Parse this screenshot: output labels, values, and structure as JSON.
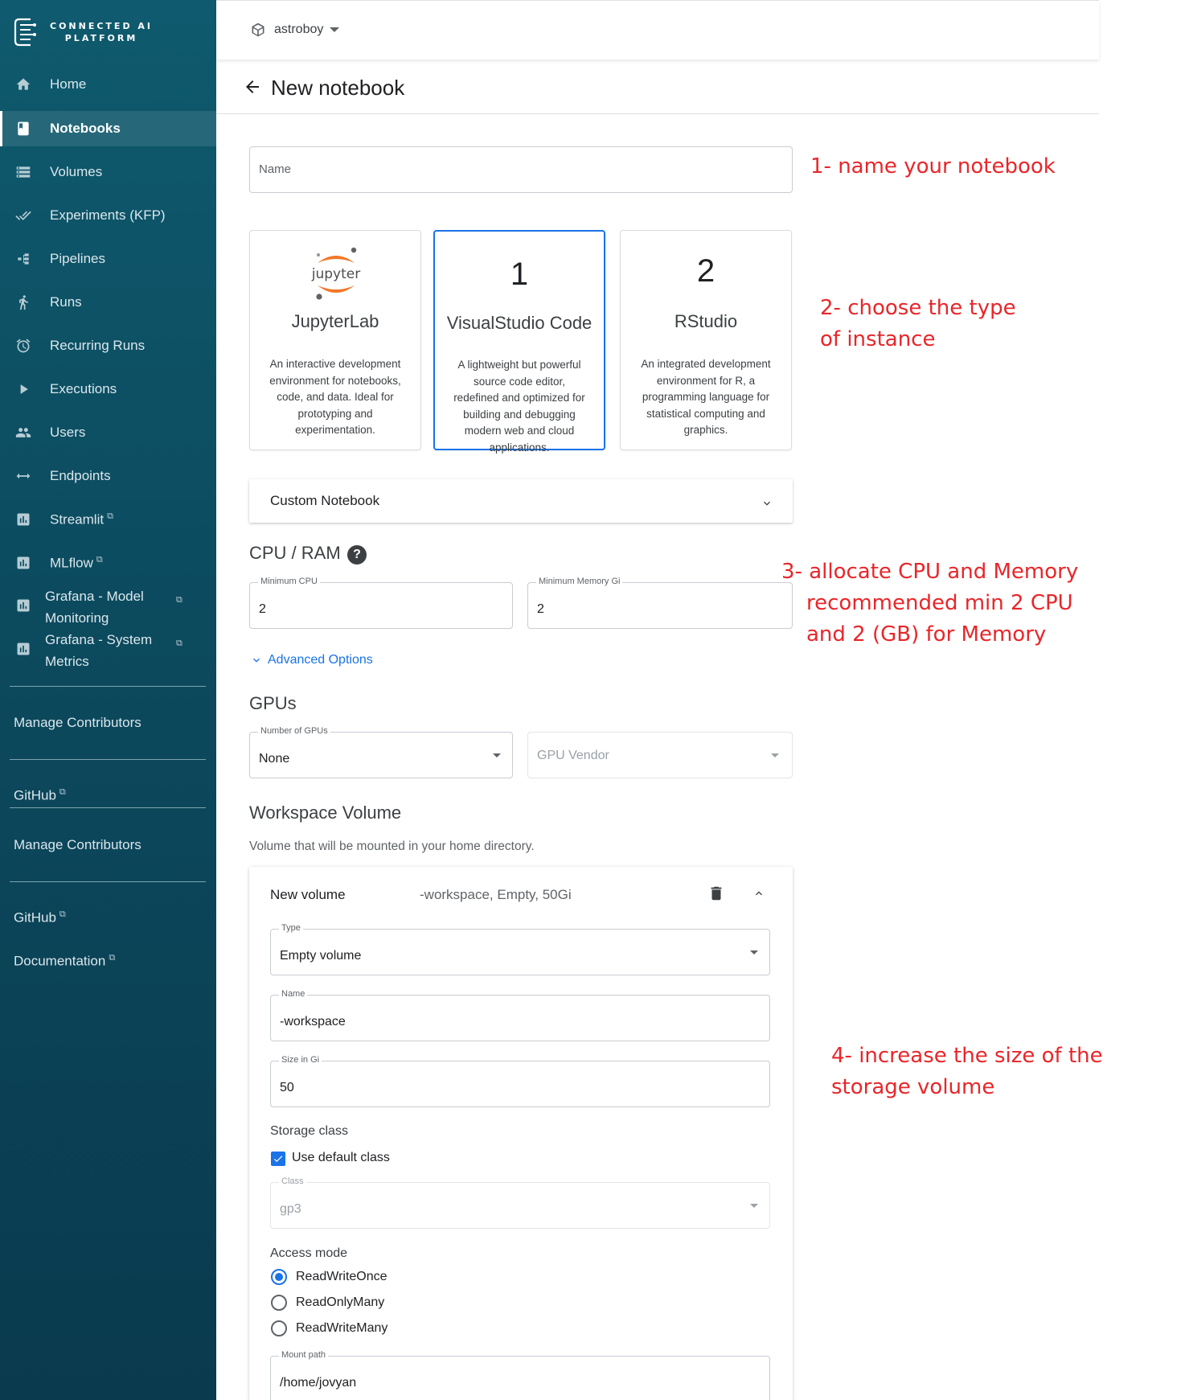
{
  "brand": {
    "line1": "CONNECTED AI",
    "line2": "PLATFORM"
  },
  "sidebar": {
    "items": [
      {
        "label": "Home",
        "icon": "home-icon"
      },
      {
        "label": "Notebooks",
        "icon": "notebook-icon",
        "active": true
      },
      {
        "label": "Volumes",
        "icon": "storage-icon"
      },
      {
        "label": "Experiments (KFP)",
        "icon": "done-all-icon"
      },
      {
        "label": "Pipelines",
        "icon": "pipeline-icon"
      },
      {
        "label": "Runs",
        "icon": "run-icon"
      },
      {
        "label": "Recurring Runs",
        "icon": "alarm-icon"
      },
      {
        "label": "Executions",
        "icon": "play-icon"
      },
      {
        "label": "Users",
        "icon": "people-icon"
      },
      {
        "label": "Endpoints",
        "icon": "endpoint-arrows-icon"
      },
      {
        "label": "Streamlit",
        "icon": "chart-icon",
        "external": true
      },
      {
        "label": "MLflow",
        "icon": "chart-icon",
        "external": true
      },
      {
        "label": "Grafana - Model Monitoring",
        "line1": "Grafana - Model",
        "line2": "Monitoring",
        "icon": "chart-icon",
        "external": true
      },
      {
        "label": "Grafana - System Metrics",
        "line1": "Grafana - System",
        "line2": "Metrics",
        "icon": "chart-icon",
        "external": true
      }
    ],
    "links": {
      "manage_contributors_1": "Manage Contributors",
      "github_1": "GitHub",
      "manage_contributors_2": "Manage Contributors",
      "github_2": "GitHub",
      "documentation": "Documentation"
    },
    "external_glyph": "⧉"
  },
  "topbar": {
    "namespace": "astroboy"
  },
  "page": {
    "title": "New notebook"
  },
  "form": {
    "name_placeholder": "Name",
    "notebook_types": [
      {
        "logo_text": "jupyter",
        "title": "JupyterLab",
        "desc": "An interactive development environment for notebooks, code, and data. Ideal for prototyping and experimentation."
      },
      {
        "number": "1",
        "title": "VisualStudio Code",
        "desc": "A lightweight but powerful source code editor, redefined and optimized for building and debugging modern web and cloud applications.",
        "selected": true
      },
      {
        "number": "2",
        "title": "RStudio",
        "desc": "An integrated development environment for R, a programming language for statistical computing and graphics."
      }
    ],
    "custom_notebook": "Custom Notebook",
    "cpu_ram": {
      "title": "CPU / RAM",
      "help_glyph": "?",
      "min_cpu_label": "Minimum CPU",
      "min_cpu_value": "2",
      "min_mem_label": "Minimum Memory Gi",
      "min_mem_value": "2"
    },
    "advanced_options": "Advanced Options",
    "gpus": {
      "title": "GPUs",
      "num_label": "Number of GPUs",
      "num_value": "None",
      "vendor_placeholder": "GPU Vendor"
    },
    "workspace": {
      "title": "Workspace Volume",
      "subtitle": "Volume that will be mounted in your home directory.",
      "volume_name": "New volume",
      "volume_summary": "-workspace, Empty, 50Gi",
      "type_label": "Type",
      "type_value": "Empty volume",
      "name_label": "Name",
      "name_value": "-workspace",
      "size_label": "Size in Gi",
      "size_value": "50",
      "storage_class_title": "Storage class",
      "use_default_class": "Use default class",
      "use_default_checked": true,
      "class_label": "Class",
      "class_value": "gp3",
      "access_mode_title": "Access mode",
      "access_modes": [
        "ReadWriteOnce",
        "ReadOnlyMany",
        "ReadWriteMany"
      ],
      "access_mode_selected": "ReadWriteOnce",
      "mount_label": "Mount path",
      "mount_value": "/home/jovyan"
    }
  },
  "annotations": {
    "step1": "1- name your notebook",
    "step2_line1": "2- choose the type",
    "step2_line2": "of instance",
    "step3_line1": "3- allocate CPU and Memory",
    "step3_line2": "recommended min 2 CPU",
    "step3_line3": "and 2 (GB) for Memory",
    "step4_line1": "4- increase the size of the",
    "step4_line2": "storage volume"
  },
  "colors": {
    "sidebar_bg": "#0c4a5e",
    "accent_blue": "#1a73e8",
    "annotation_red": "#e8262a",
    "jupyter_orange": "#f37726"
  }
}
